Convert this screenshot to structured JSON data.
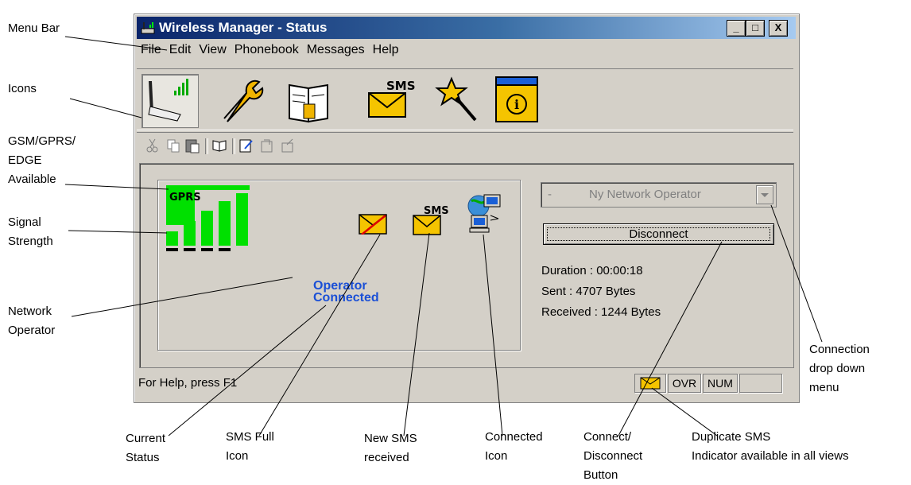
{
  "window": {
    "title": "Wireless Manager - Status",
    "controls": [
      "_",
      "□",
      "X"
    ]
  },
  "menu": [
    "File",
    "Edit",
    "View",
    "Phonebook",
    "Messages",
    "Help"
  ],
  "big_toolbar": [
    "connection-status-icon",
    "settings-wrench-icon",
    "phonebook-icon",
    "sms-icon",
    "wizard-icon",
    "info-icon"
  ],
  "small_toolbar": [
    "cut-icon",
    "copy-icon",
    "paste-icon",
    "phonebook-small-icon",
    "compose-icon",
    "inbox-icon",
    "outbox-icon"
  ],
  "status_panel": {
    "network_type": "GPRS",
    "signal_bars": 4,
    "operator_status_line1": "Operator",
    "operator_status_line2": "Connected",
    "sms_badge": "SMS"
  },
  "connection": {
    "operator_prefix": "-",
    "operator": "Ny Network Operator",
    "button_label": "Disconnect",
    "duration": "Duration : 00:00:18",
    "sent": "Sent : 4707  Bytes",
    "received": "Received : 1244 Bytes"
  },
  "statusbar": {
    "help": "For Help, press F1",
    "ovr": "OVR",
    "num": "NUM"
  },
  "annotations": {
    "menu_bar": "Menu Bar",
    "icons": "Icons",
    "gsm_1": "GSM/GPRS/",
    "gsm_2": "EDGE",
    "gsm_3": "Available",
    "signal_1": "Signal",
    "signal_2": "Strength",
    "network_1": "Network",
    "network_2": "Operator",
    "current_1": "Current",
    "current_2": "Status",
    "smsfull_1": "SMS Full",
    "smsfull_2": "Icon",
    "newsms_1": "New SMS",
    "newsms_2": "received",
    "connected_1": "Connected",
    "connected_2": "Icon",
    "connbtn_1": "Connect/",
    "connbtn_2": "Disconnect",
    "connbtn_3": "Button",
    "dup_1": "Duplicate SMS",
    "dup_2": "Indicator available in all views",
    "dropdown_1": "Connection",
    "dropdown_2": "drop down",
    "dropdown_3": "menu"
  },
  "colors": {
    "titlebar_start": "#0a246a",
    "titlebar_end": "#a6caf0",
    "status_blue": "#1a4fd6",
    "signal_green": "#00e000",
    "envelope_yellow": "#f5c400"
  }
}
